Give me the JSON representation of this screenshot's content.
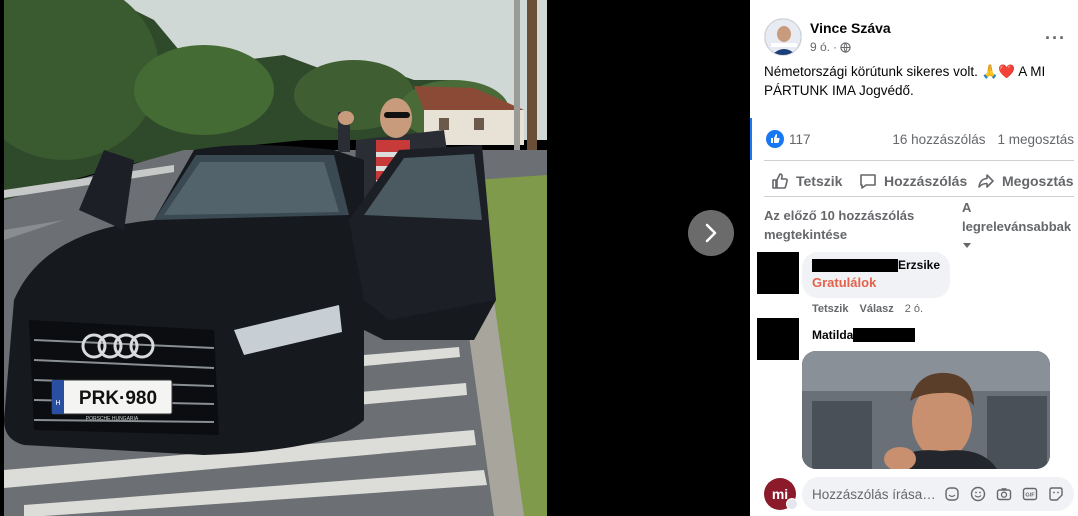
{
  "post": {
    "author": "Vince Száva",
    "time": "9 ó.",
    "meta_sep": "·",
    "text": "Németországi körútunk sikeres volt. 🙏❤️ A MI PÁRTUNK IMA Jogvédő.",
    "reaction_count": "117",
    "comment_count": "16 hozzászólás",
    "share_count": "1 megosztás",
    "more_label": "···"
  },
  "photo": {
    "license_plate": "PRK·980",
    "plate_country": "H",
    "dealer_plate_text": "PORSCHE HUNGARIA"
  },
  "actions": {
    "like": "Tetszik",
    "comment": "Hozzászólás",
    "share": "Megosztás"
  },
  "comments_header": {
    "view_previous": "Az előző 10 hozzászólás megtekintése",
    "sort": "A legrelevánsabbak"
  },
  "comments": [
    {
      "name_visible": "Erzsike",
      "text": "Gratulálok",
      "like": "Tetszik",
      "reply": "Válasz",
      "time": "2 ó."
    },
    {
      "name_visible": "Matilda",
      "has_gif": true
    }
  ],
  "composer": {
    "avatar_initials": "mi",
    "placeholder": "Hozzászólás írása…"
  },
  "colors": {
    "accent": "#1877f2",
    "comment_highlight": "#e4624b",
    "muted": "#65676b",
    "bubble": "#f0f2f5"
  },
  "icons": {
    "next": "chevron-right-icon",
    "globe": "globe-icon",
    "like": "thumbs-up-icon",
    "comment": "speech-bubble-icon",
    "share": "share-arrow-icon",
    "sort": "caret-down-icon",
    "composer_tools": [
      "sticker-icon",
      "emoji-icon",
      "camera-icon",
      "gif-icon",
      "sticker-face-icon"
    ]
  }
}
